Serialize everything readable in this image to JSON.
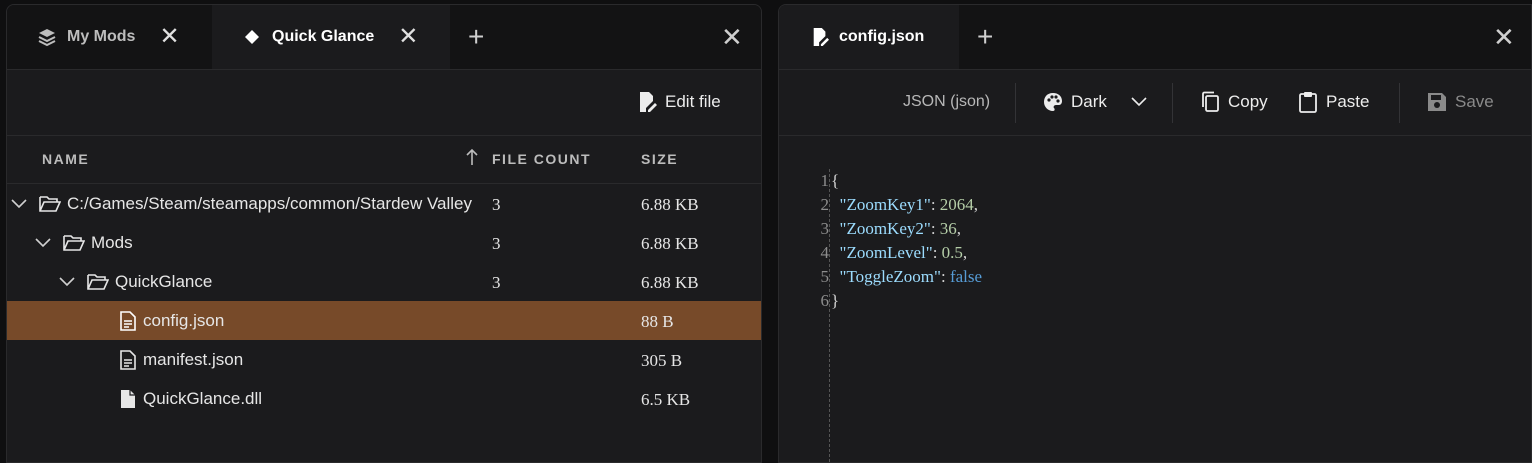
{
  "left_pane": {
    "tabs": [
      {
        "label": "My Mods",
        "icon": "layers-icon",
        "active": false
      },
      {
        "label": "Quick Glance",
        "icon": "diamond-icon",
        "active": true
      }
    ],
    "toolbar": {
      "edit_file_label": "Edit file"
    },
    "table": {
      "columns": {
        "name": "NAME",
        "file_count": "FILE COUNT",
        "size": "SIZE"
      },
      "sort_icon": "arrow-up-icon",
      "rows": [
        {
          "name": "C:/Games/Steam/steamapps/common/Stardew Valley",
          "file_count": "3",
          "size": "6.88 KB",
          "type": "folder",
          "expanded": true
        },
        {
          "name": "Mods",
          "file_count": "3",
          "size": "6.88 KB",
          "type": "folder",
          "expanded": true
        },
        {
          "name": "QuickGlance",
          "file_count": "3",
          "size": "6.88 KB",
          "type": "folder",
          "expanded": true
        },
        {
          "name": "config.json",
          "file_count": "",
          "size": "88 B",
          "type": "text-file",
          "selected": true
        },
        {
          "name": "manifest.json",
          "file_count": "",
          "size": "305 B",
          "type": "text-file"
        },
        {
          "name": "QuickGlance.dll",
          "file_count": "",
          "size": "6.5 KB",
          "type": "file"
        }
      ]
    }
  },
  "right_pane": {
    "tab": {
      "label": "config.json",
      "icon": "file-edit-icon"
    },
    "toolbar": {
      "language": "JSON (json)",
      "theme": "Dark",
      "copy_label": "Copy",
      "paste_label": "Paste",
      "save_label": "Save"
    },
    "editor": {
      "line_numbers": [
        "1",
        "2",
        "3",
        "4",
        "5",
        "6"
      ],
      "lines": [
        {
          "parts": [
            [
              "p",
              "{"
            ]
          ]
        },
        {
          "parts": [
            [
              "p",
              "  "
            ],
            [
              "k",
              "\"ZoomKey1\""
            ],
            [
              "p",
              ": "
            ],
            [
              "n",
              "2064"
            ],
            [
              "p",
              ","
            ]
          ]
        },
        {
          "parts": [
            [
              "p",
              "  "
            ],
            [
              "k",
              "\"ZoomKey2\""
            ],
            [
              "p",
              ": "
            ],
            [
              "n",
              "36"
            ],
            [
              "p",
              ","
            ]
          ]
        },
        {
          "parts": [
            [
              "p",
              "  "
            ],
            [
              "k",
              "\"ZoomLevel\""
            ],
            [
              "p",
              ": "
            ],
            [
              "n",
              "0.5"
            ],
            [
              "p",
              ","
            ]
          ]
        },
        {
          "parts": [
            [
              "p",
              "  "
            ],
            [
              "k",
              "\"ToggleZoom\""
            ],
            [
              "p",
              ": "
            ],
            [
              "b",
              "false"
            ]
          ]
        },
        {
          "parts": [
            [
              "p",
              "}"
            ]
          ]
        }
      ]
    }
  },
  "colors": {
    "selected_row": "#774a29",
    "background": "#1b1b1d",
    "tabbar": "#131314"
  }
}
